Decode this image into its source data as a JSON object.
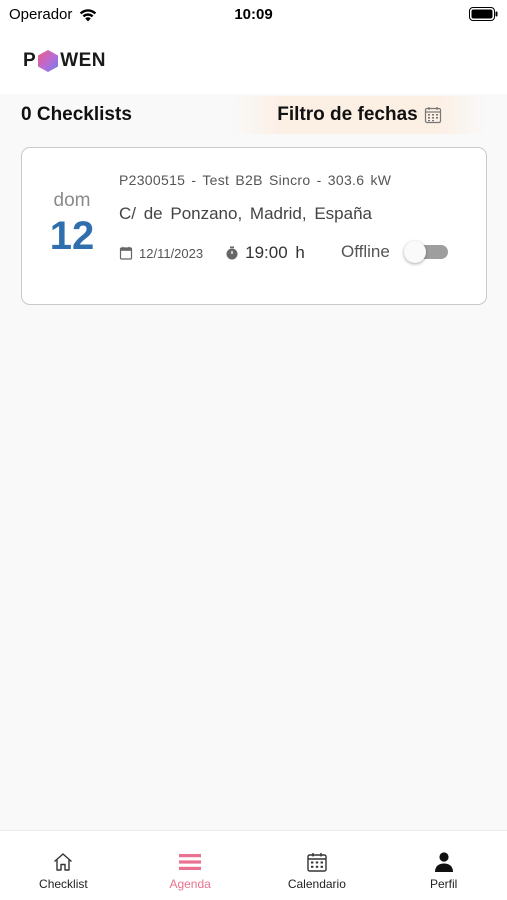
{
  "status_bar": {
    "carrier": "Operador",
    "time": "10:09"
  },
  "header": {
    "logo_left": "P",
    "logo_right": "WEN"
  },
  "toolbar": {
    "count_label": "0 Checklists",
    "filter_label": "Filtro de fechas"
  },
  "checklists": [
    {
      "day_name": "dom",
      "day_number": "12",
      "title": "P2300515 - Test B2B Sincro - 303.6 kW",
      "address": "C/ de Ponzano, Madrid, España",
      "date": "12/11/2023",
      "time": "19:00 h",
      "offline_label": "Offline",
      "offline_enabled": false
    }
  ],
  "bottom_nav": {
    "items": [
      {
        "label": "Checklist",
        "icon": "home-icon",
        "active": false
      },
      {
        "label": "Agenda",
        "icon": "menu-icon",
        "active": true
      },
      {
        "label": "Calendario",
        "icon": "calendar-icon",
        "active": false
      },
      {
        "label": "Perfil",
        "icon": "person-icon",
        "active": false
      }
    ]
  },
  "colors": {
    "accent_pink": "#e8728f",
    "day_number_blue": "#2f6fae",
    "filter_background": "#fcefe4",
    "toggle_off": "#9e9e9e"
  }
}
